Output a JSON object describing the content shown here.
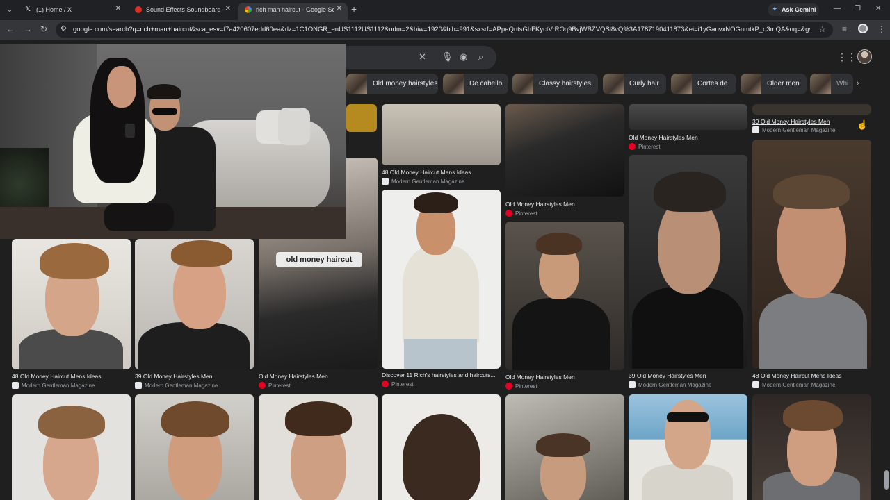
{
  "browser": {
    "tabs": [
      {
        "title": "(1) Home / X",
        "close": "✕"
      },
      {
        "title": "Sound Effects Soundboard - Ca",
        "close": "✕"
      },
      {
        "title": "rich man haircut - Google Sear",
        "close": "✕"
      }
    ],
    "new_tab": "+",
    "ask_gemini": "Ask Gemini",
    "url": "google.com/search?q=rich+man+haircut&sca_esv=f7a420607edd60ea&rlz=1C1ONGR_enUS1112US1112&udm=2&biw=1920&bih=991&sxsrf=APpeQntsGhFKyctVrROq9BvjWBZVQSl8vQ%3A1787190411873&ei=i1yGaovxNOGnmtkP_o3mQA&oq=&gs_lp="
  },
  "chips": [
    {
      "label": "Old money hairstyles"
    },
    {
      "label": "De cabello"
    },
    {
      "label": "Classy hairstyles"
    },
    {
      "label": "Curly hair"
    },
    {
      "label": "Cortes de"
    },
    {
      "label": "Older men"
    },
    {
      "label": "Whi"
    }
  ],
  "results": {
    "r1c2": {
      "caption": "48 Old Money Haircut Mens Ideas",
      "source": "Modern Gentleman Magazine"
    },
    "r1c3": {
      "caption": "Old Money Hairstyles Men",
      "source": "Pinterest"
    },
    "r1c4": {
      "caption": "Old Money Hairstyles Men",
      "source": "Pinterest"
    },
    "r1c5": {
      "caption": "39 Old Money Hairstyles Men",
      "source": "Modern Gentleman Magazine"
    },
    "r2c0": {
      "caption": "48 Old Money Haircut Mens Ideas",
      "source": "Modern Gentleman Magazine"
    },
    "r2c1": {
      "caption": "39 Old Money Hairstyles Men",
      "source": "Modern Gentleman Magazine"
    },
    "r2c2": {
      "caption": "Old Money Hairstyles Men",
      "source": "Pinterest",
      "overlay": "old money haircut"
    },
    "r2c3": {
      "caption": "Discover 11 Rich's hairstyles and haircuts...",
      "source": "Pinterest"
    },
    "r2c4": {
      "caption": "Old Money Hairstyles Men",
      "source": "Pinterest"
    },
    "r2c5": {
      "caption": "39 Old Money Hairstyles Men",
      "source": "Modern Gentleman Magazine"
    },
    "r2c6": {
      "caption": "48 Old Money Haircut Mens Ideas",
      "source": "Modern Gentleman Magazine"
    }
  },
  "colors": {
    "background": "#1f1f1f",
    "chip": "#303134",
    "pinterest": "#e60023"
  },
  "icons": [
    "search-icon",
    "mic-icon",
    "lens-icon",
    "clear-icon",
    "apps-grid-icon",
    "star-icon",
    "back-icon",
    "forward-icon",
    "reload-icon"
  ]
}
